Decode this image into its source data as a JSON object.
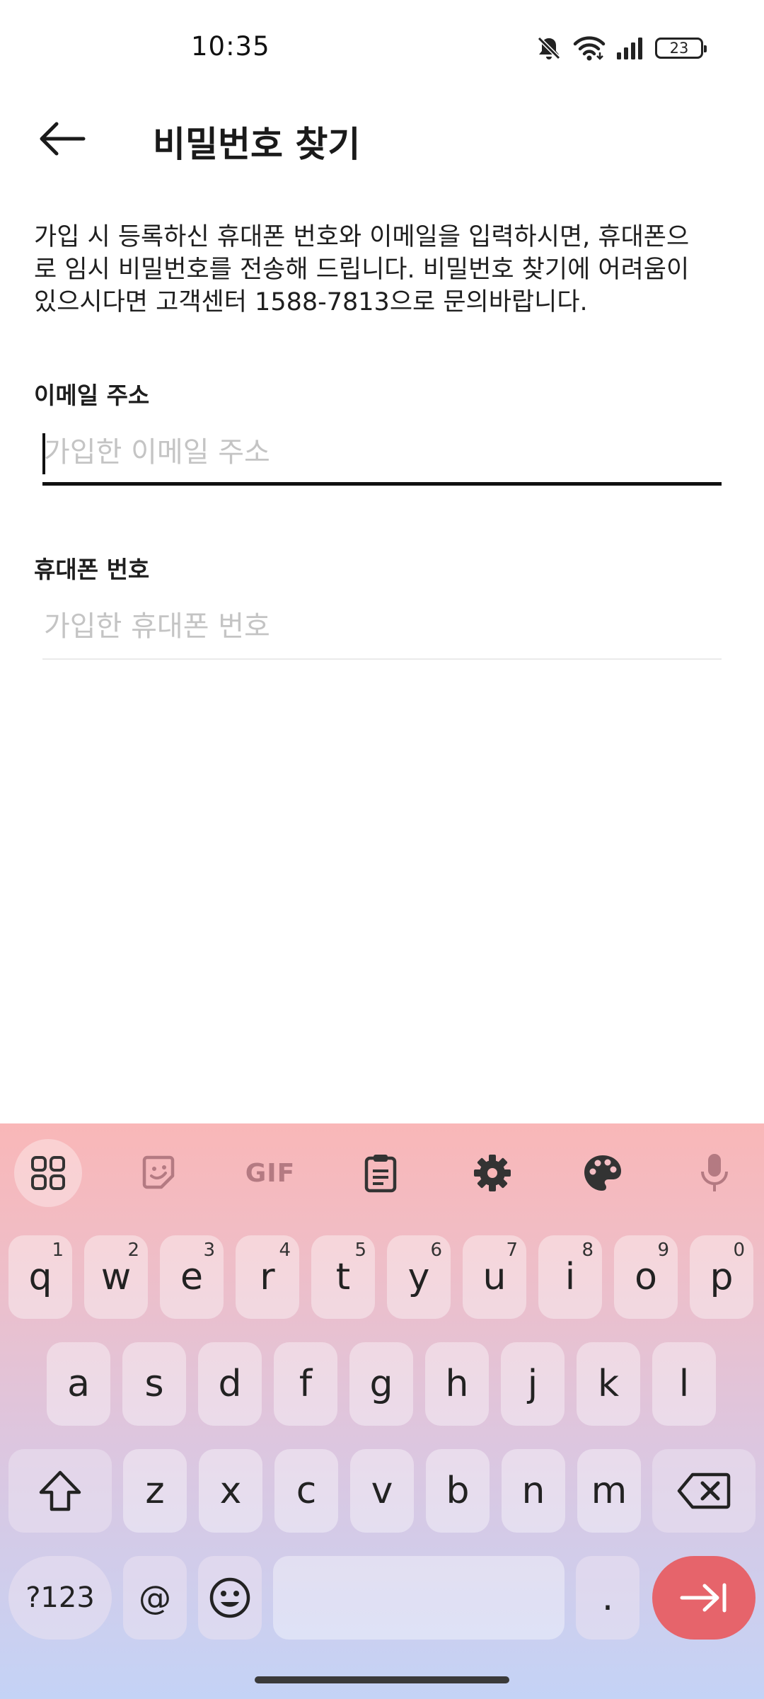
{
  "status_bar": {
    "time": "10:35",
    "battery": "23",
    "icons": [
      "mute-icon",
      "wifi-icon",
      "signal-icon",
      "battery-icon"
    ]
  },
  "header": {
    "title": "비밀번호 찾기",
    "back_icon": "arrow-left-icon"
  },
  "description": "가입 시 등록하신 휴대폰 번호와 이메일을 입력하시면, 휴대폰으\n로 임시 비밀번호를 전송해 드립니다. 비밀번호 찾기에 어려움이\n있으시다면 고객센터 1588-7813으로 문의바랍니다.",
  "form": {
    "email": {
      "label": "이메일 주소",
      "placeholder": "가입한 이메일 주소",
      "value": ""
    },
    "phone": {
      "label": "휴대폰 번호",
      "placeholder": "가입한 휴대폰 번호",
      "value": ""
    }
  },
  "keyboard": {
    "toolbar": [
      "apps-icon",
      "sticker-icon",
      "gif-icon",
      "clipboard-icon",
      "settings-gear-icon",
      "palette-icon",
      "microphone-icon"
    ],
    "gif_label": "GIF",
    "row1": [
      {
        "k": "q",
        "h": "1"
      },
      {
        "k": "w",
        "h": "2"
      },
      {
        "k": "e",
        "h": "3"
      },
      {
        "k": "r",
        "h": "4"
      },
      {
        "k": "t",
        "h": "5"
      },
      {
        "k": "y",
        "h": "6"
      },
      {
        "k": "u",
        "h": "7"
      },
      {
        "k": "i",
        "h": "8"
      },
      {
        "k": "o",
        "h": "9"
      },
      {
        "k": "p",
        "h": "0"
      }
    ],
    "row2": [
      "a",
      "s",
      "d",
      "f",
      "g",
      "h",
      "j",
      "k",
      "l"
    ],
    "row3": [
      "z",
      "x",
      "c",
      "v",
      "b",
      "n",
      "m"
    ],
    "sym_label": "?123",
    "at_label": "@",
    "period_label": ".",
    "colors": {
      "enter": "#e6646b",
      "keyboard_top": "#f9b7b8",
      "keyboard_bottom": "#c4d3f6"
    }
  }
}
